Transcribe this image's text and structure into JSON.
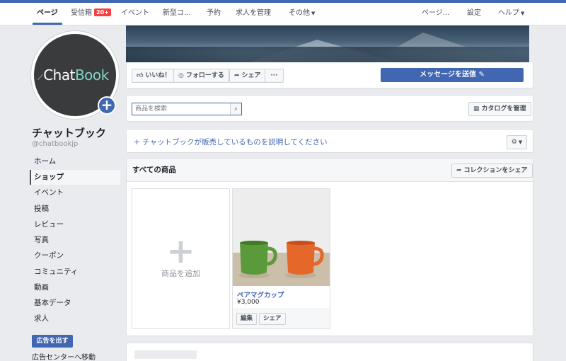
{
  "topbar": {
    "tabs": [
      {
        "label": "ページ"
      },
      {
        "label": "受信箱",
        "badge": "20+"
      },
      {
        "label": "イベント"
      },
      {
        "label": "新型コ..."
      },
      {
        "label": "予約"
      },
      {
        "label": "求人を管理"
      },
      {
        "label": "その他"
      }
    ],
    "right": [
      "ページ...",
      "設定",
      "ヘルプ"
    ]
  },
  "profile": {
    "logo_part1": "Chat",
    "logo_part2": "Book",
    "name": "チャットブック",
    "handle": "@chatbookjp"
  },
  "sidebar": {
    "items": [
      "ホーム",
      "ショップ",
      "イベント",
      "投稿",
      "レビュー",
      "写真",
      "クーポン",
      "コミュニティ",
      "動画",
      "基本データ",
      "求人"
    ],
    "active_index": 1,
    "ad_button": "広告を出す",
    "ad_center_link": "広告センターへ移動"
  },
  "actions": {
    "like": "いいね！",
    "follow": "フォローする",
    "share": "シェア",
    "more": "···",
    "message": "メッセージを送信"
  },
  "shop": {
    "search_placeholder": "商品を検索",
    "manage_catalog": "カタログを管理",
    "describe_prompt": "+ チャットブックが販売しているものを説明してください",
    "all_products_title": "すべての商品",
    "share_collection": "コレクションをシェア",
    "add_product": "商品を追加",
    "products": [
      {
        "name": "ペアマグカップ",
        "price": "¥3,000",
        "edit": "編集",
        "share": "シェア"
      }
    ]
  },
  "colors": {
    "brand_blue": "#4267b2",
    "badge_red": "#fa3e3e",
    "mug_green": "#5b9a3a",
    "mug_orange": "#e5672a"
  }
}
